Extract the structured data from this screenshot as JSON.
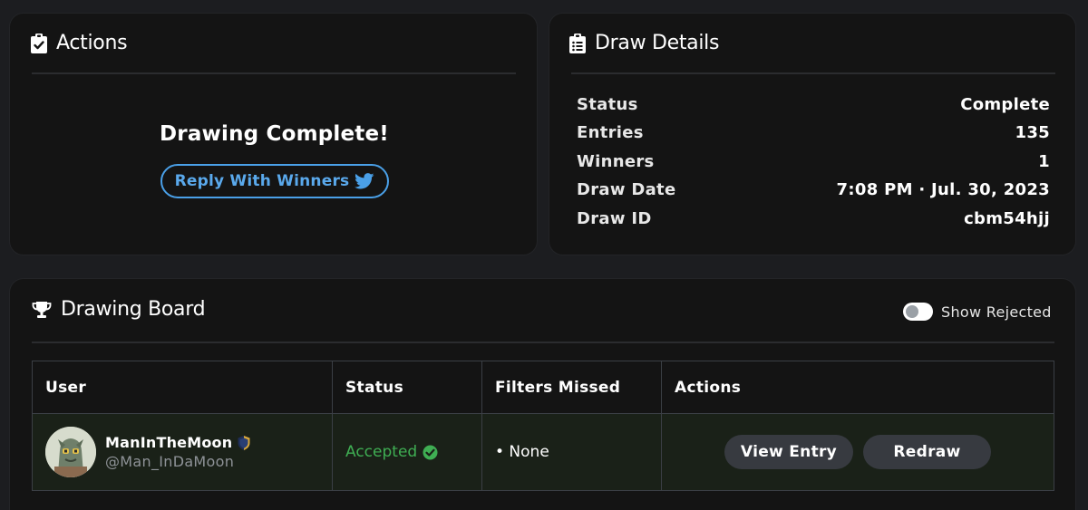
{
  "actions": {
    "title": "Actions",
    "message": "Drawing Complete!",
    "reply_button": "Reply With Winners"
  },
  "details": {
    "title": "Draw Details",
    "rows": [
      {
        "label": "Status",
        "value": "Complete"
      },
      {
        "label": "Entries",
        "value": "135"
      },
      {
        "label": "Winners",
        "value": "1"
      },
      {
        "label": "Draw Date",
        "value": "7:08 PM · Jul. 30, 2023"
      },
      {
        "label": "Draw ID",
        "value": "cbm54hjj"
      }
    ]
  },
  "board": {
    "title": "Drawing Board",
    "toggle_label": "Show Rejected",
    "toggle_on": false,
    "columns": [
      "User",
      "Status",
      "Filters Missed",
      "Actions"
    ],
    "rows": [
      {
        "name": "ManInTheMoon",
        "handle": "@Man_InDaMoon",
        "status": "Accepted",
        "filters_missed": "• None",
        "view_label": "View Entry",
        "redraw_label": "Redraw"
      }
    ]
  },
  "colors": {
    "background": "#1c1d20",
    "card": "#141414",
    "accent_twitter": "#4aa0e8",
    "accepted_green": "#3fae53",
    "row_highlight": "#1a2118"
  },
  "icons": {
    "actions": "clipboard-check-icon",
    "details": "clipboard-list-icon",
    "board": "trophy-icon",
    "reply": "twitter-bird-icon",
    "accepted": "check-circle-icon",
    "verified": "verified-badge-icon"
  }
}
